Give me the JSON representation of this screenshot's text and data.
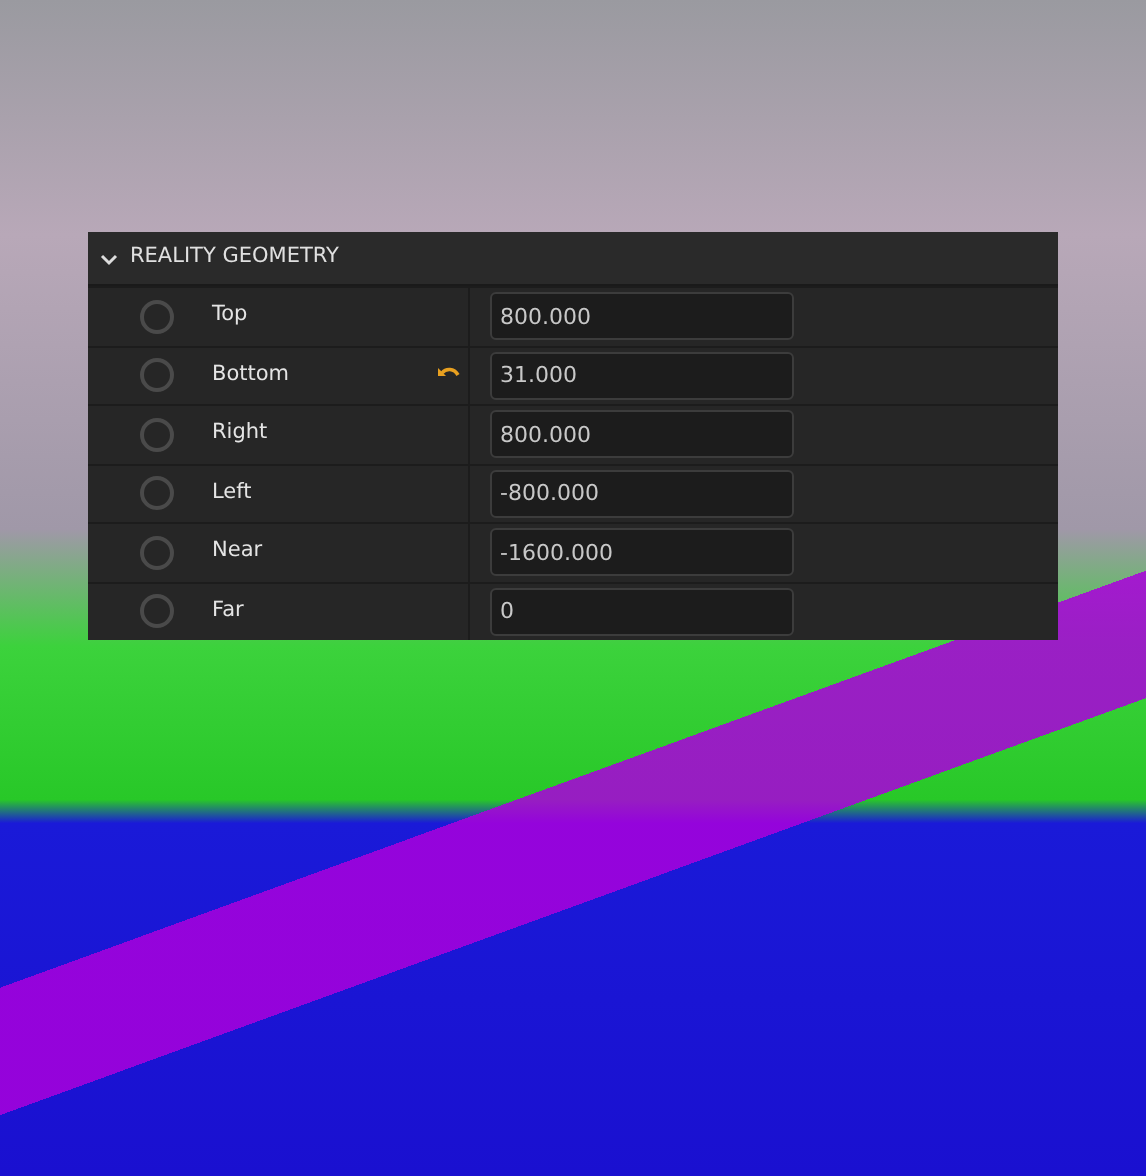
{
  "panel": {
    "title": "REALITY GEOMETRY",
    "expanded": true,
    "rows": [
      {
        "label": "Top",
        "value": "800.000",
        "checked": false,
        "modified": false
      },
      {
        "label": "Bottom",
        "value": "31.000",
        "checked": false,
        "modified": true
      },
      {
        "label": "Right",
        "value": "800.000",
        "checked": false,
        "modified": false
      },
      {
        "label": "Left",
        "value": "-800.000",
        "checked": false,
        "modified": false
      },
      {
        "label": "Near",
        "value": "-1600.000",
        "checked": false,
        "modified": false
      },
      {
        "label": "Far",
        "value": "0",
        "checked": false,
        "modified": false
      }
    ]
  }
}
